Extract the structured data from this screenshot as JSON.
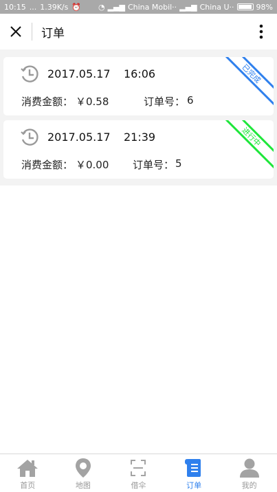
{
  "status_bar": {
    "time": "10:15",
    "dots": "...",
    "speed": "1.39K/s",
    "carrier1": "China Mobil··",
    "carrier2": "China U··",
    "battery": "98%"
  },
  "header": {
    "title": "订单"
  },
  "orders": [
    {
      "date": "2017.05.17",
      "time": "16:06",
      "amount_label": "消费金额：",
      "amount": "￥0.58",
      "order_label": "订单号：",
      "order_no": "6",
      "status": "已完成",
      "status_color": "#2f80ed"
    },
    {
      "date": "2017.05.17",
      "time": "21:39",
      "amount_label": "消费金额：",
      "amount": "￥0.00",
      "order_label": "订单号：",
      "order_no": "5",
      "status": "进行中",
      "status_color": "#1ee63a"
    }
  ],
  "tabs": [
    {
      "label": "首页",
      "icon": "home-icon",
      "active": false
    },
    {
      "label": "地图",
      "icon": "map-pin-icon",
      "active": false
    },
    {
      "label": "借伞",
      "icon": "scan-icon",
      "active": false
    },
    {
      "label": "订单",
      "icon": "order-scroll-icon",
      "active": true
    },
    {
      "label": "我的",
      "icon": "user-icon",
      "active": false
    }
  ],
  "colors": {
    "accent": "#2f80ed",
    "inactive_icon": "#a3a3a3",
    "done": "#2f80ed",
    "active": "#1ee63a"
  }
}
